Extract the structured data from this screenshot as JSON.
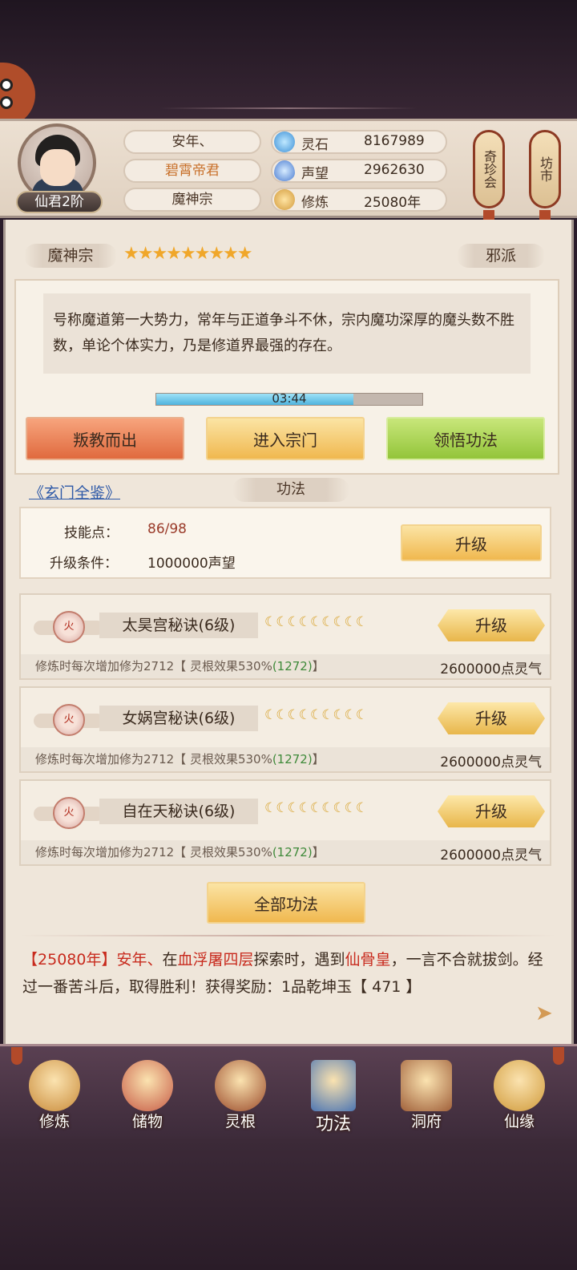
{
  "player": {
    "rank": "仙君2阶",
    "name": "安年、",
    "title": "碧霄帝君",
    "sect": "魔神宗",
    "stats": [
      {
        "icon": "spirit-stone-icon",
        "label": "灵石",
        "value": "8167989"
      },
      {
        "icon": "reputation-icon",
        "label": "声望",
        "value": "2962630"
      },
      {
        "icon": "cultivation-icon",
        "label": "修炼",
        "value": "25080年"
      }
    ]
  },
  "side_tags": [
    "奇珍会",
    "坊市"
  ],
  "sect_info": {
    "name": "魔神宗",
    "stars": "★★★★★★★★★",
    "alignment": "邪派",
    "description": "号称魔道第一大势力，常年与正道争斗不休，宗内魔功深厚的魔头数不胜数，单论个体实力，乃是修道界最强的存在。",
    "timer": "03:44",
    "timer_progress": 0.74
  },
  "actions": [
    "叛教而出",
    "进入宗门",
    "领悟功法"
  ],
  "link": "《玄门全鉴》",
  "section_title": "功法",
  "skill_points": {
    "label": "技能点：",
    "value": "86/98",
    "cond_label": "升级条件：",
    "cond_value": "1000000声望",
    "button": "升级"
  },
  "techniques": [
    {
      "element": "火",
      "name": "太昊宫秘诀(6级)",
      "moons": "☾☾☾☾☾☾☾☾☾",
      "button": "升级",
      "effect_a": "修炼时每次增加修为2712【 灵根效果530%",
      "effect_b": "(1272)",
      "effect_c": "】",
      "cost": "2600000点灵气"
    },
    {
      "element": "火",
      "name": "女娲宫秘诀(6级)",
      "moons": "☾☾☾☾☾☾☾☾☾",
      "button": "升级",
      "effect_a": "修炼时每次增加修为2712【 灵根效果530%",
      "effect_b": "(1272)",
      "effect_c": "】",
      "cost": "2600000点灵气"
    },
    {
      "element": "火",
      "name": "自在天秘诀(6级)",
      "moons": "☾☾☾☾☾☾☾☾☾",
      "button": "升级",
      "effect_a": "修炼时每次增加修为2712【 灵根效果530%",
      "effect_b": "(1272)",
      "effect_c": "】",
      "cost": "2600000点灵气"
    }
  ],
  "all_button": "全部功法",
  "log": {
    "p1": "【",
    "year": "25080年",
    "p2": "】",
    "name": "安年、",
    "p3": "在",
    "place": "血浮屠四层",
    "p4": "探索时，遇到",
    "enemy": "仙骨皇",
    "p5": "，一言不合就拔剑。经过一番苦斗后，取得胜利！获得奖励：1品乾坤玉【 471 】"
  },
  "nav": [
    {
      "label": "修炼",
      "icon": "meditating-monk-icon",
      "color": "#c98b3a"
    },
    {
      "label": "储物",
      "icon": "treasure-bag-icon",
      "color": "#c65a45"
    },
    {
      "label": "灵根",
      "icon": "spirit-root-icon",
      "color": "#9a4a2a"
    },
    {
      "label": "功法",
      "icon": "scripture-book-icon",
      "color": "#4d76b2"
    },
    {
      "label": "洞府",
      "icon": "cave-house-icon",
      "color": "#a0603a"
    },
    {
      "label": "仙缘",
      "icon": "gourd-icon",
      "color": "#d09a3a"
    }
  ]
}
